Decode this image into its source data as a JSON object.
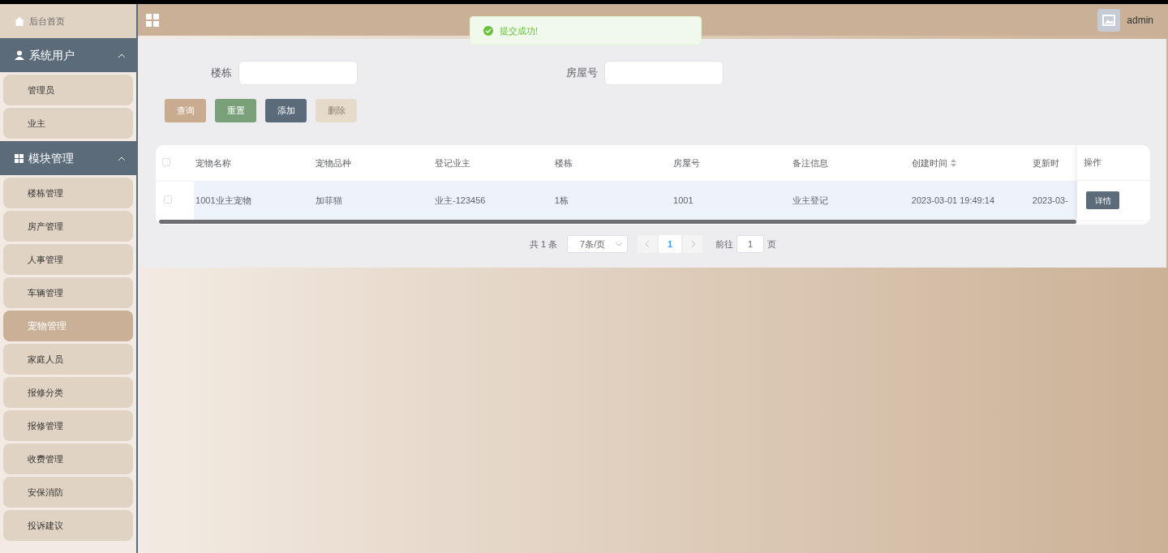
{
  "sidebar": {
    "home": "后台首页",
    "groups": [
      {
        "title": "系统用户",
        "expanded": true,
        "items": [
          {
            "label": "管理员",
            "selected": false
          },
          {
            "label": "业主",
            "selected": false
          }
        ]
      },
      {
        "title": "模块管理",
        "expanded": true,
        "items": [
          {
            "label": "楼栋管理",
            "selected": false
          },
          {
            "label": "房产管理",
            "selected": false
          },
          {
            "label": "人事管理",
            "selected": false
          },
          {
            "label": "车辆管理",
            "selected": false
          },
          {
            "label": "宠物管理",
            "selected": true
          },
          {
            "label": "家庭人员",
            "selected": false
          },
          {
            "label": "报修分类",
            "selected": false
          },
          {
            "label": "报修管理",
            "selected": false
          },
          {
            "label": "收费管理",
            "selected": false
          },
          {
            "label": "安保消防",
            "selected": false
          },
          {
            "label": "投诉建议",
            "selected": false
          }
        ]
      }
    ]
  },
  "header": {
    "user": "admin"
  },
  "toast": {
    "kind": "success",
    "text": "提交成功!"
  },
  "filters": [
    {
      "label": "楼栋"
    },
    {
      "label": "房屋号"
    }
  ],
  "buttons": [
    {
      "label": "查询",
      "kind": "query",
      "disabled": false
    },
    {
      "label": "重置",
      "kind": "reset",
      "disabled": false
    },
    {
      "label": "添加",
      "kind": "add",
      "disabled": false
    },
    {
      "label": "删除",
      "kind": "delete",
      "disabled": true
    }
  ],
  "table": {
    "select_all_checked": false,
    "columns": [
      {
        "label": "宠物名称",
        "sortable": false
      },
      {
        "label": "宠物品种",
        "sortable": false
      },
      {
        "label": "登记业主",
        "sortable": false
      },
      {
        "label": "楼栋",
        "sortable": false
      },
      {
        "label": "房屋号",
        "sortable": false
      },
      {
        "label": "备注信息",
        "sortable": false
      },
      {
        "label": "创建时间",
        "sortable": true
      },
      {
        "label": "更新时",
        "sortable": false
      }
    ],
    "action_column": "操作",
    "rows": [
      {
        "checked": false,
        "cells": [
          "1001业主宠物",
          "加菲猫",
          "业主-123456",
          "1栋",
          "1001",
          "业主登记",
          "2023-03-01 19:49:14",
          "2023-03-"
        ],
        "action": "详情"
      }
    ]
  },
  "pagination": {
    "total": "共 1 条",
    "page_size": "7条/页",
    "pages": [
      {
        "label": "1",
        "selected": true
      }
    ],
    "goto_label": "前往",
    "goto_value": "1",
    "goto_suffix": "页"
  }
}
